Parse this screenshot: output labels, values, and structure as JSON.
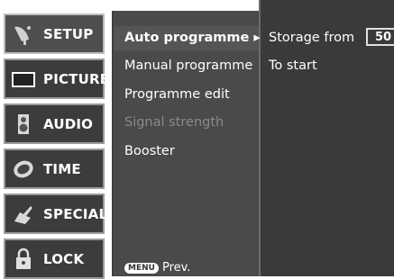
{
  "sidebar": {
    "items": [
      {
        "label": "SETUP",
        "icon": "satellite-dish-icon"
      },
      {
        "label": "PICTURE",
        "icon": "tv-screen-icon"
      },
      {
        "label": "AUDIO",
        "icon": "speaker-icon"
      },
      {
        "label": "TIME",
        "icon": "clock-icon"
      },
      {
        "label": "SPECIAL",
        "icon": "hand-icon"
      },
      {
        "label": "LOCK",
        "icon": "padlock-icon"
      }
    ]
  },
  "menu": {
    "items": [
      {
        "label": "Auto programme ▸",
        "state": "active"
      },
      {
        "label": "Manual programme",
        "state": "normal"
      },
      {
        "label": "Programme edit",
        "state": "normal"
      },
      {
        "label": "Signal strength",
        "state": "disabled"
      },
      {
        "label": "Booster",
        "state": "normal"
      }
    ]
  },
  "submenu": {
    "storage_label": "Storage from",
    "storage_value": "50",
    "start_label": "To start"
  },
  "footer": {
    "key": "MENU",
    "label": "Prev."
  }
}
